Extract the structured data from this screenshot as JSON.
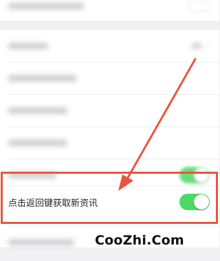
{
  "settings": {
    "highlighted_item": {
      "label": "点击返回键获取新资讯",
      "toggle_on": true
    },
    "toggle_on_color": "#4cd964"
  },
  "annotation": {
    "frame_color": "#e8553f"
  },
  "watermark": {
    "text": "CooZhi.Com"
  }
}
